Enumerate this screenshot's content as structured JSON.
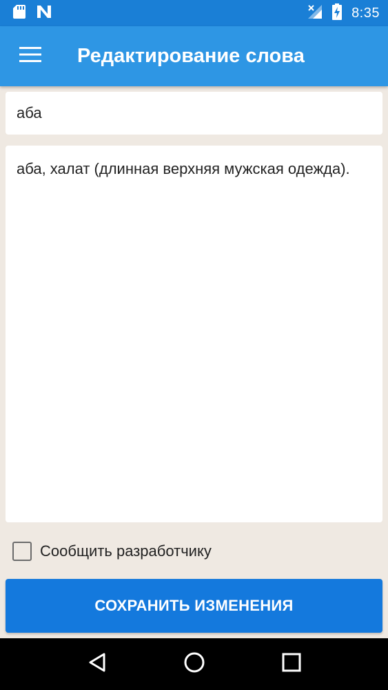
{
  "status_bar": {
    "time": "8:35",
    "icons": [
      "sd-card-icon",
      "n-notification-icon",
      "no-signal-icon",
      "battery-charging-icon"
    ]
  },
  "app_bar": {
    "title": "Редактирование слова",
    "menu_icon": "hamburger-menu-icon"
  },
  "form": {
    "word_value": "аба",
    "definition_value": "аба, халат (длинная верхняя мужская одежда).",
    "report_checkbox_label": "Сообщить разработчику",
    "report_checked": false,
    "save_label": "СОХРАНИТЬ ИЗМЕНЕНИЯ"
  },
  "nav_bar": {
    "icons": [
      "back-icon",
      "home-icon",
      "recents-icon"
    ]
  },
  "colors": {
    "status_bar": "#1a7fd6",
    "app_bar": "#2e96e4",
    "background": "#efe9e2",
    "button": "#1479dd"
  }
}
